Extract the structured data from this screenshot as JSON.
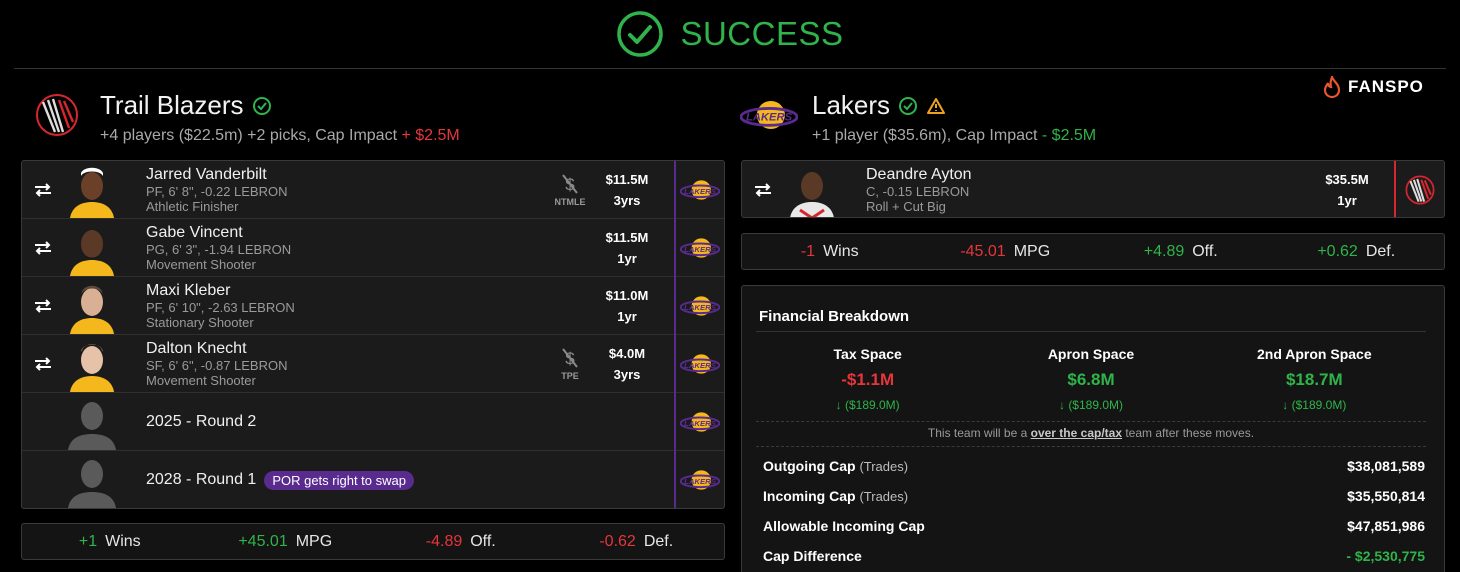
{
  "status": {
    "text": "SUCCESS"
  },
  "brand": {
    "name": "FANSPO"
  },
  "left_team": {
    "name": "Trail Blazers",
    "summary": "+4 players ($22.5m) +2 picks, Cap Impact",
    "cap_impact": "+ $2.5M",
    "players": [
      {
        "name": "Jarred Vanderbilt",
        "line": "PF, 6' 8\", -0.22 LEBRON",
        "role": "Athletic Finisher",
        "tag": "NTMLE",
        "salary": "$11.5M",
        "years": "3yrs"
      },
      {
        "name": "Gabe Vincent",
        "line": "PG, 6' 3\", -1.94 LEBRON",
        "role": "Movement Shooter",
        "tag": "",
        "salary": "$11.5M",
        "years": "1yr"
      },
      {
        "name": "Maxi Kleber",
        "line": "PF, 6' 10\", -2.63 LEBRON",
        "role": "Stationary Shooter",
        "tag": "",
        "salary": "$11.0M",
        "years": "1yr"
      },
      {
        "name": "Dalton Knecht",
        "line": "SF, 6' 6\", -0.87 LEBRON",
        "role": "Movement Shooter",
        "tag": "TPE",
        "salary": "$4.0M",
        "years": "3yrs"
      }
    ],
    "picks": [
      {
        "name": "2025 - Round 2",
        "badge": ""
      },
      {
        "name": "2028 - Round 1",
        "badge": "POR gets right to swap"
      }
    ],
    "stats": [
      {
        "value": "+1",
        "label": "Wins",
        "tone": "pos"
      },
      {
        "value": "+45.01",
        "label": "MPG",
        "tone": "pos"
      },
      {
        "value": "-4.89",
        "label": "Off.",
        "tone": "neg"
      },
      {
        "value": "-0.62",
        "label": "Def.",
        "tone": "neg"
      }
    ]
  },
  "right_team": {
    "name": "Lakers",
    "summary": "+1 player ($35.6m), Cap Impact",
    "cap_impact": "- $2.5M",
    "players": [
      {
        "name": "Deandre Ayton",
        "line": "C, -0.15 LEBRON",
        "role": "Roll + Cut Big",
        "salary": "$35.5M",
        "years": "1yr"
      }
    ],
    "stats": [
      {
        "value": "-1",
        "label": "Wins",
        "tone": "neg"
      },
      {
        "value": "-45.01",
        "label": "MPG",
        "tone": "neg"
      },
      {
        "value": "+4.89",
        "label": "Off.",
        "tone": "pos"
      },
      {
        "value": "+0.62",
        "label": "Def.",
        "tone": "pos"
      }
    ]
  },
  "financial": {
    "title": "Financial Breakdown",
    "spaces": [
      {
        "label": "Tax Space",
        "value": "-$1.1M",
        "delta": "($189.0M)",
        "tone": "neg"
      },
      {
        "label": "Apron Space",
        "value": "$6.8M",
        "delta": "($189.0M)",
        "tone": "pos"
      },
      {
        "label": "2nd Apron Space",
        "value": "$18.7M",
        "delta": "($189.0M)",
        "tone": "pos"
      }
    ],
    "note_prefix": "This team will be a",
    "note_link": "over the cap/tax",
    "note_suffix": "team after these moves.",
    "rows": [
      {
        "label": "Outgoing Cap",
        "sub": "(Trades)",
        "value": "$38,081,589"
      },
      {
        "label": "Incoming Cap",
        "sub": "(Trades)",
        "value": "$35,550,814"
      },
      {
        "label": "Allowable Incoming Cap",
        "sub": "",
        "value": "$47,851,986"
      },
      {
        "label": "Cap Difference",
        "sub": "",
        "value": "- $2,530,775"
      }
    ]
  },
  "colors": {
    "positive": "#2fb34a",
    "negative": "#e5363b",
    "lakers_purple": "#5a2b8f",
    "lakers_gold": "#f5b81c",
    "blazers_red": "#d6262e"
  }
}
